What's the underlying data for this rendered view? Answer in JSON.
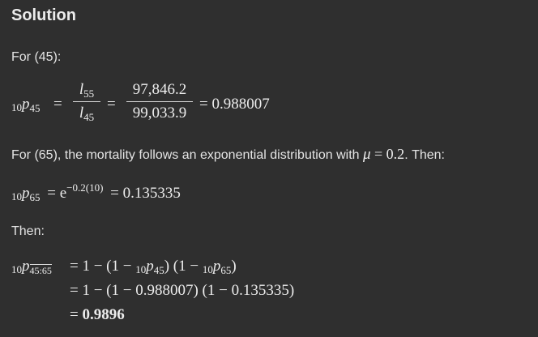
{
  "heading": "Solution",
  "for45_label": "For (45):",
  "eq1": {
    "lhs_pre": "10",
    "lhs_p": "p",
    "lhs_sub": "45",
    "eq_sign": "=",
    "num_l": "l",
    "num_sub": "55",
    "den_l": "l",
    "den_sub": "45",
    "num_value": "97,846.2",
    "den_value": "99,033.9",
    "result": "= 0.988007"
  },
  "para65": {
    "text_before": "For (65), the mortality follows an exponential distribution with ",
    "mu": "μ",
    "mu_eq": " = 0.2",
    "text_after": ". Then:"
  },
  "eq2": {
    "pre": "10",
    "p": "p",
    "sub": "65",
    "rhs_base": "= e",
    "exponent": "−0.2(10)",
    "result": "= 0.135335"
  },
  "then_label": "Then:",
  "eq3": {
    "pre": "10",
    "p": "p",
    "sub": "45:65",
    "line1_a": "= 1 − (1 − ",
    "line1_pre1": "10",
    "line1_p1": "p",
    "line1_sub1": "45",
    "line1_b": ") (1 − ",
    "line1_pre2": "10",
    "line1_p2": "p",
    "line1_sub2": "65",
    "line1_c": ")",
    "line2": "= 1 − (1 − 0.988007) (1 − 0.135335)",
    "line3_eq": "= ",
    "line3_val": "0.9896"
  }
}
